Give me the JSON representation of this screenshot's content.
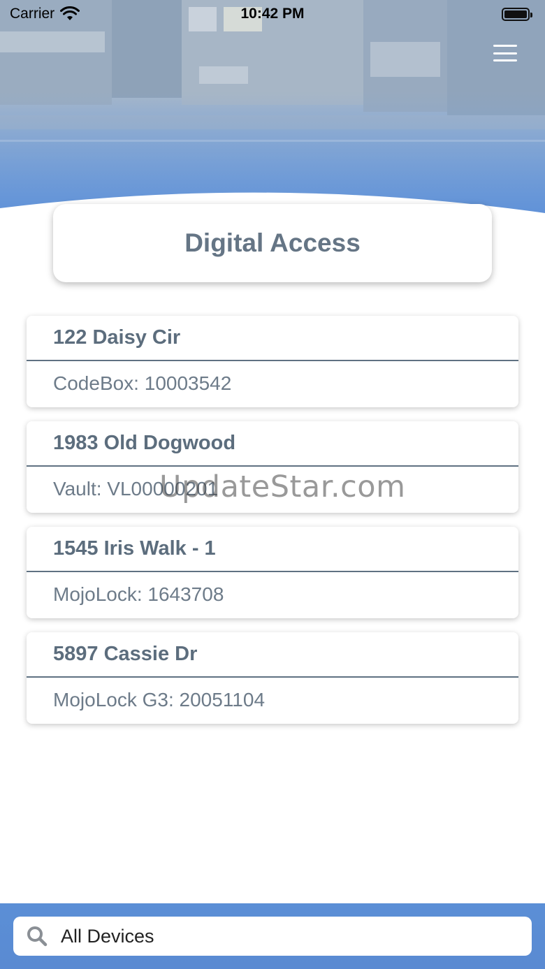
{
  "status_bar": {
    "carrier": "Carrier",
    "time": "10:42 PM",
    "icons": [
      "wifi-icon",
      "battery-icon"
    ]
  },
  "header": {
    "menu_icon": "hamburger-menu-icon",
    "background": "building-photo-with-blue-tint"
  },
  "title": "Digital Access",
  "properties": [
    {
      "address": "122 Daisy Cir",
      "device": "CodeBox: 10003542"
    },
    {
      "address": "1983 Old Dogwood",
      "device": "Vault: VL00000201"
    },
    {
      "address": "1545 Iris Walk - 1",
      "device": "MojoLock: 1643708"
    },
    {
      "address": "5897 Cassie Dr",
      "device": "MojoLock G3: 20051104"
    }
  ],
  "watermark": "UpdateStar.com",
  "search": {
    "icon": "search-icon",
    "value": "All Devices"
  },
  "colors": {
    "accent_blue": "#5b8fd6",
    "text_gray": "#5f6f7f"
  }
}
